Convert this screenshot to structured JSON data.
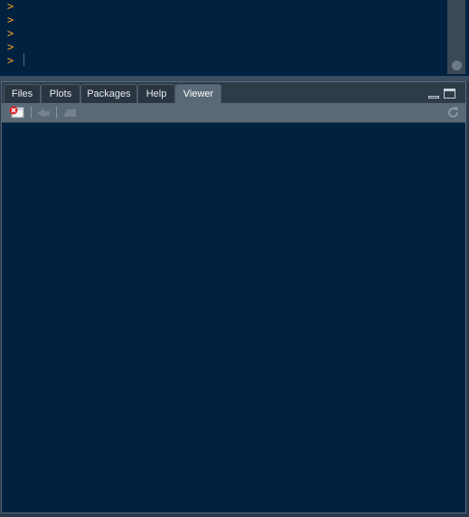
{
  "console": {
    "prompts": [
      ">",
      ">",
      ">",
      ">",
      ">"
    ]
  },
  "tabs": [
    {
      "label": "Files",
      "active": false
    },
    {
      "label": "Plots",
      "active": false
    },
    {
      "label": "Packages",
      "active": false
    },
    {
      "label": "Help",
      "active": false
    },
    {
      "label": "Viewer",
      "active": true
    }
  ],
  "toolbar": {
    "icons": [
      "clear-viewer-icon",
      "back-arrow-icon",
      "forward-arrow-icon",
      "refresh-icon"
    ]
  },
  "colors": {
    "background": "#002240",
    "prompt": "#f4a020",
    "active_tab": "#596977"
  }
}
